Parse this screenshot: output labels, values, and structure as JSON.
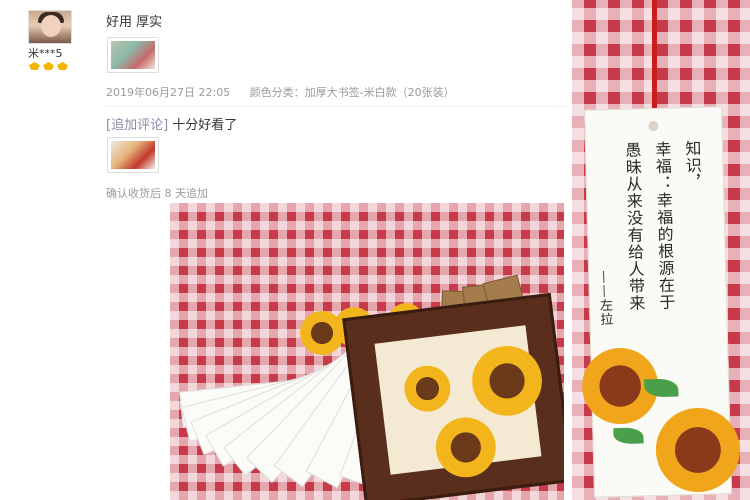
{
  "reviewer": {
    "username": "米***5"
  },
  "review": {
    "text": "好用 厚实",
    "date": "2019年06月27日 22:05",
    "sku": "颜色分类：加厚大书签-米白款（20张装）"
  },
  "followup": {
    "tag": "[追加评论]",
    "text": "十分好看了",
    "note": "确认收货后 8 天追加"
  },
  "bookmark": {
    "poem_cols": [
      "知识，",
      "幸福：幸福的根源在于",
      "愚昧从来没有给人带来",
      "——左拉"
    ]
  },
  "icons": [
    "avatar",
    "gem-badge-icon",
    "gem-badge-icon",
    "gem-badge-icon"
  ],
  "colors": {
    "meta_text": "#9a9a9a",
    "tag_text": "#8a8aa8",
    "badge": "#f1b400"
  }
}
